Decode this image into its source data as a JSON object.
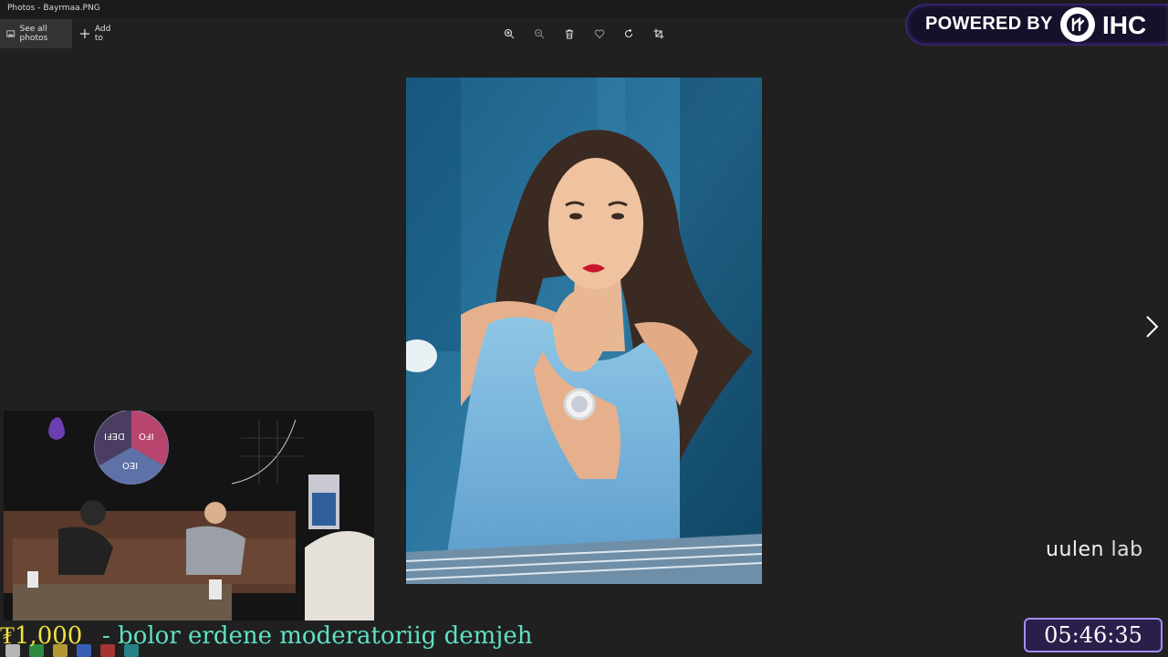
{
  "window": {
    "title": "Photos - Bayrmaa.PNG"
  },
  "commandbar": {
    "see_all_label": "See all photos",
    "add_to_label": "Add to"
  },
  "toolbar": {
    "icons": [
      "zoom-in-icon",
      "zoom-out-icon",
      "delete-icon",
      "favorite-icon",
      "rotate-icon",
      "crop-icon"
    ]
  },
  "banner": {
    "powered_by": "POWERED BY",
    "brand": "IHC"
  },
  "watermark": {
    "brand": "uulen",
    "suffix": "lab"
  },
  "webcam": {
    "board_segments": [
      "IFO",
      "DEFI",
      "IEO"
    ]
  },
  "ticker": {
    "amount": "₮1,000",
    "message": "- bolor erdene moderatoriig demjeh"
  },
  "clock": {
    "time": "05:46:35"
  },
  "colors": {
    "ticker_amount": "#f2e13a",
    "ticker_message": "#5fe0c4",
    "clock_border": "#a38cff",
    "banner_bg": "#16112a"
  }
}
